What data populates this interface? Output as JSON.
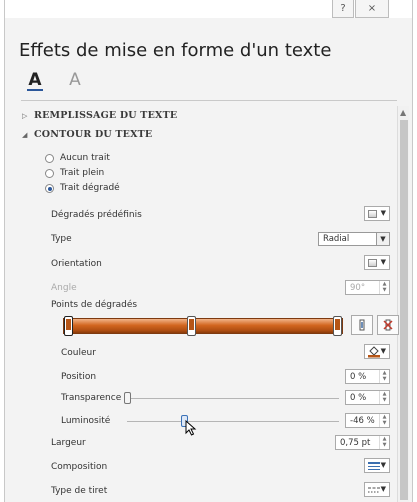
{
  "window": {
    "help_label": "?",
    "close_label": "×"
  },
  "panel": {
    "title": "Effets de mise en forme d'un texte",
    "tabs": [
      {
        "glyph": "A",
        "name": "text-fill-outline-tab",
        "selected": true
      },
      {
        "glyph": "A",
        "name": "text-effects-tab",
        "selected": false
      }
    ]
  },
  "sections": {
    "fill": {
      "label": "REMPLISSAGE DU TEXTE",
      "expanded": false
    },
    "outline": {
      "label": "CONTOUR DU TEXTE",
      "expanded": true
    }
  },
  "outline_options": [
    {
      "label": "Aucun trait",
      "checked": false
    },
    {
      "label": "Trait plein",
      "checked": false
    },
    {
      "label": "Trait dégradé",
      "checked": true
    }
  ],
  "rows": {
    "presets": {
      "label": "Dégradés prédéfinis"
    },
    "type": {
      "label": "Type",
      "value": "Radial"
    },
    "orientation": {
      "label": "Orientation"
    },
    "angle": {
      "label": "Angle",
      "value": "90°",
      "disabled": true
    },
    "stops": {
      "label": "Points de dégradés"
    },
    "color": {
      "label": "Couleur"
    },
    "position": {
      "label": "Position",
      "value": "0 %"
    },
    "transparency": {
      "label": "Transparence",
      "value": "0 %",
      "slider_fraction": 0.0
    },
    "luminosity": {
      "label": "Luminosité",
      "value": "-46 %",
      "slider_fraction": 0.27
    },
    "width": {
      "label": "Largeur",
      "value": "0,75 pt"
    },
    "composition": {
      "label": "Composition"
    },
    "dash_type": {
      "label": "Type de tiret"
    }
  },
  "gradient_stops": [
    {
      "position_fraction": 0.02,
      "selected": true
    },
    {
      "position_fraction": 0.46,
      "selected": false
    },
    {
      "position_fraction": 0.98,
      "selected": false
    }
  ],
  "colors": {
    "accent": "#2b579a",
    "gradient_light": "#f2b48a",
    "gradient_mid": "#d2661f",
    "gradient_dark": "#8a3b0b"
  }
}
